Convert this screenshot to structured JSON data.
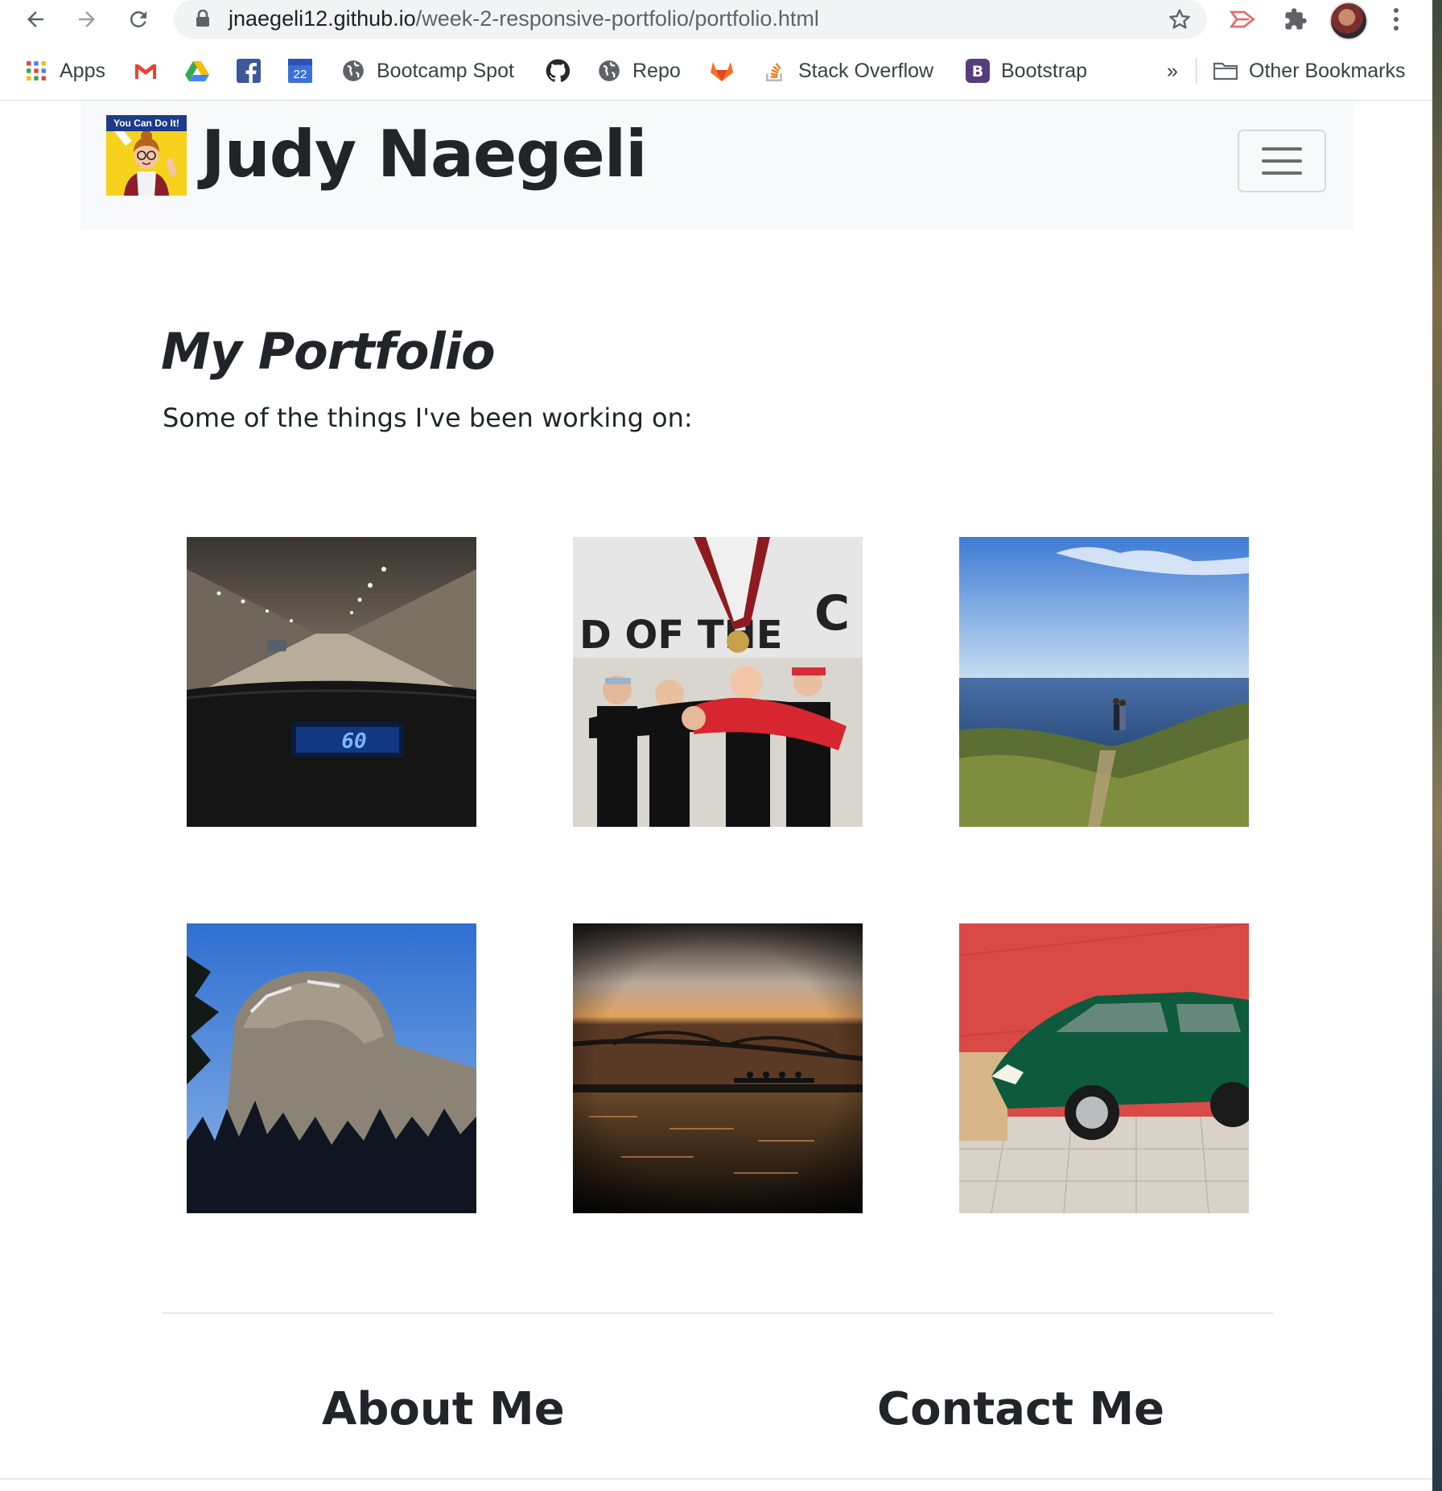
{
  "browser": {
    "url_host": "jnaegeli12.github.io",
    "url_path": "/week-2-responsive-portfolio/portfolio.html",
    "bookmarks": [
      {
        "label": "Apps",
        "icon": "apps-grid-icon"
      },
      {
        "label": "",
        "icon": "gmail-icon"
      },
      {
        "label": "",
        "icon": "google-drive-icon"
      },
      {
        "label": "",
        "icon": "facebook-icon"
      },
      {
        "label": "22",
        "icon": "calendar-icon"
      },
      {
        "label": "Bootcamp Spot",
        "icon": "globe-icon"
      },
      {
        "label": "",
        "icon": "github-icon"
      },
      {
        "label": "Repo",
        "icon": "globe-icon"
      },
      {
        "label": "",
        "icon": "gitlab-icon"
      },
      {
        "label": "Stack Overflow",
        "icon": "stackoverflow-icon"
      },
      {
        "label": "Bootstrap",
        "icon": "bootstrap-icon"
      }
    ],
    "overflow_label": "»",
    "other_bookmarks": "Other Bookmarks"
  },
  "site": {
    "logo_text": "You Can Do It!",
    "brand_name": "Judy Naegeli"
  },
  "portfolio": {
    "title": "My Portfolio",
    "subtitle": "Some of the things I've been working on:",
    "speedometer_text": "60",
    "medal_banner_text": "D OF THE",
    "medal_banner_letter": "C",
    "images": [
      {
        "name": "tunnel-dashboard"
      },
      {
        "name": "rowing-team-medal"
      },
      {
        "name": "coastline-couple"
      },
      {
        "name": "half-dome-mountain"
      },
      {
        "name": "sunset-bridge-rowing"
      },
      {
        "name": "green-car-red-wall"
      }
    ]
  },
  "footer": {
    "about": "About Me",
    "contact": "Contact Me"
  },
  "colors": {
    "navbar_bg": "#f8f9fa",
    "text": "#212529",
    "logo_yellow": "#f6d21c"
  }
}
